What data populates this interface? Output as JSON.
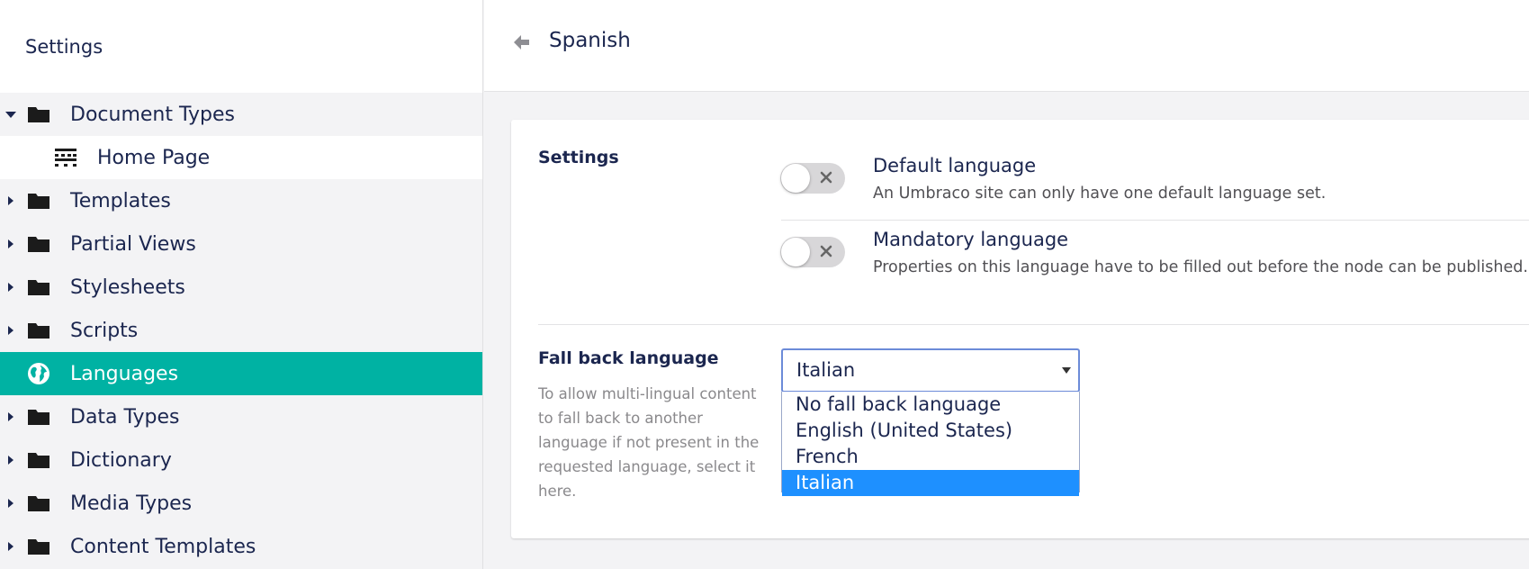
{
  "sidebar": {
    "title": "Settings",
    "items": [
      {
        "label": "Document Types",
        "icon": "folder-icon",
        "caret": "expanded"
      },
      {
        "label": "Home Page",
        "icon": "document-type-icon",
        "caret": "none"
      },
      {
        "label": "Templates",
        "icon": "folder-icon",
        "caret": "collapsed"
      },
      {
        "label": "Partial Views",
        "icon": "folder-icon",
        "caret": "collapsed"
      },
      {
        "label": "Stylesheets",
        "icon": "folder-icon",
        "caret": "collapsed"
      },
      {
        "label": "Scripts",
        "icon": "folder-icon",
        "caret": "collapsed"
      },
      {
        "label": "Languages",
        "icon": "globe-icon",
        "caret": "none",
        "active": true
      },
      {
        "label": "Data Types",
        "icon": "folder-icon",
        "caret": "collapsed"
      },
      {
        "label": "Dictionary",
        "icon": "folder-icon",
        "caret": "collapsed"
      },
      {
        "label": "Media Types",
        "icon": "folder-icon",
        "caret": "collapsed"
      },
      {
        "label": "Content Templates",
        "icon": "folder-icon",
        "caret": "collapsed"
      }
    ]
  },
  "header": {
    "title": "Spanish",
    "back_icon": "arrow-left-icon"
  },
  "settings": {
    "label": "Settings",
    "default_language": {
      "title": "Default language",
      "description": "An Umbraco site can only have one default language set.",
      "enabled": false
    },
    "mandatory_language": {
      "title": "Mandatory language",
      "description": "Properties on this language have to be filled out before the node can be published.",
      "enabled": false
    }
  },
  "fallback": {
    "label": "Fall back language",
    "description": "To allow multi-lingual content to fall back to another language if not present in the requested language, select it here.",
    "selected": "Italian",
    "options": [
      "No fall back language",
      "English (United States)",
      "French",
      "Italian"
    ]
  },
  "colors": {
    "accent": "#00b2a3",
    "text": "#1b264f",
    "selection": "#1e90ff"
  }
}
